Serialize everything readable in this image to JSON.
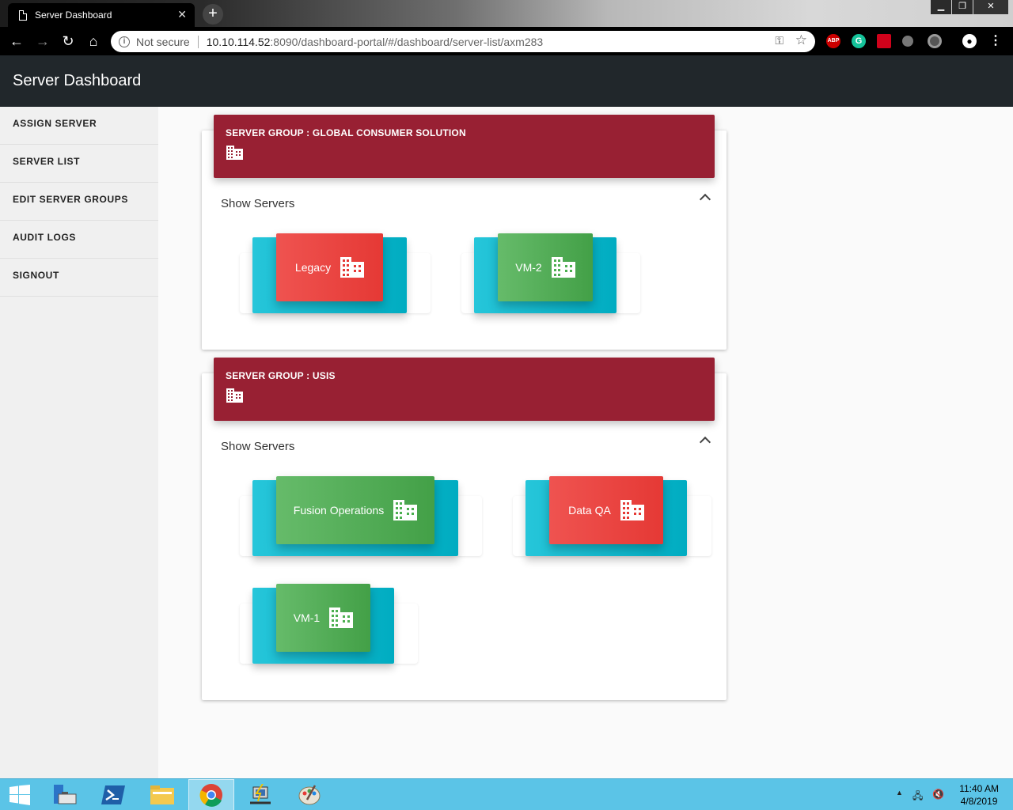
{
  "browser": {
    "tab_title": "Server Dashboard",
    "tab_close": "✕",
    "new_tab": "+",
    "window_buttons": {
      "minimize": "▁",
      "restore": "❐",
      "close": "✕"
    },
    "nav": {
      "back": "←",
      "forward": "→",
      "reload": "↻",
      "home": "⌂"
    },
    "security_label": "Not secure",
    "url_host": "10.10.114.52",
    "url_path": ":8090/dashboard-portal/#/dashboard/server-list/axm283",
    "extensions": [
      "abp-icon",
      "grammarly-icon",
      "red-extension-icon",
      "location-icon",
      "circle-extension-icon",
      "profile-icon",
      "menu-icon"
    ]
  },
  "app": {
    "title": "Server Dashboard"
  },
  "sidebar": {
    "items": [
      {
        "label": "ASSIGN SERVER"
      },
      {
        "label": "SERVER LIST"
      },
      {
        "label": "EDIT SERVER GROUPS"
      },
      {
        "label": "AUDIT LOGS"
      },
      {
        "label": "SIGNOUT"
      }
    ]
  },
  "groups": [
    {
      "title": "SERVER GROUP : GLOBAL CONSUMER SOLUTION",
      "toggle_label": "Show Servers",
      "servers": [
        {
          "name": "Legacy",
          "status_color": "#e53935"
        },
        {
          "name": "VM-2",
          "status_color": "#43a047"
        }
      ]
    },
    {
      "title": "SERVER GROUP : USIS",
      "toggle_label": "Show Servers",
      "servers": [
        {
          "name": "Fusion Operations",
          "status_color": "#43a047"
        },
        {
          "name": "Data QA",
          "status_color": "#e53935"
        },
        {
          "name": "VM-1",
          "status_color": "#43a047"
        }
      ]
    }
  ],
  "taskbar": {
    "time": "11:40 AM",
    "date": "4/8/2019",
    "apps": [
      "windows-start-icon",
      "server-manager-icon",
      "powershell-icon",
      "file-explorer-icon",
      "chrome-icon",
      "network-tool-icon",
      "paint-icon"
    ]
  },
  "colors": {
    "header_bg": "#21272b",
    "group_header": "#982033",
    "teal": "#00acc1",
    "red_tile": "#e53935",
    "green_tile": "#43a047"
  }
}
